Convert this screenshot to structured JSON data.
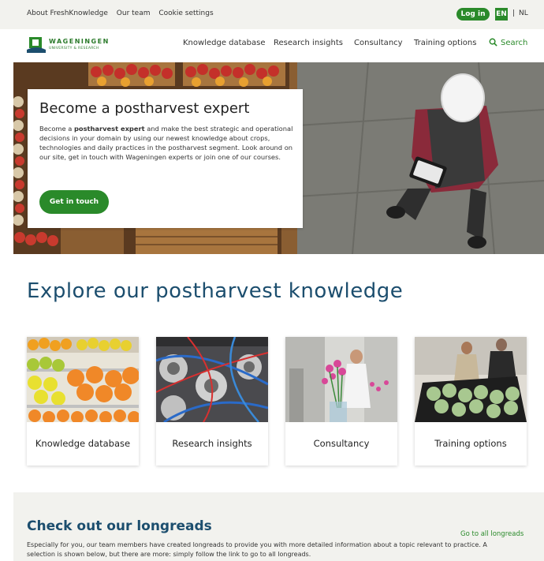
{
  "topbar": {
    "links": [
      "About FreshKnowledge",
      "Our team",
      "Cookie settings"
    ],
    "login_label": "Log in",
    "lang_en": "EN",
    "lang_sep": "|",
    "lang_nl": "NL"
  },
  "logo": {
    "name": "WAGENINGEN",
    "subtitle": "UNIVERSITY & RESEARCH"
  },
  "nav": {
    "items": [
      "Knowledge database",
      "Research insights",
      "Consultancy",
      "Training options"
    ],
    "search_label": "Search"
  },
  "hero": {
    "title": "Become a postharvest expert",
    "intro_pre": "Become a ",
    "intro_bold": "postharvest expert",
    "intro_post": " and make the best strategic and operational decisions in your domain by using our newest knowledge about crops, technologies and daily practices in the postharvest segment. Look around on our site, get in touch with Wageningen experts or join one of our courses.",
    "cta_label": "Get in touch"
  },
  "explore": {
    "title": "Explore our postharvest knowledge",
    "tiles": [
      {
        "label": "Knowledge database",
        "image": "citrus-shelf"
      },
      {
        "label": "Research insights",
        "image": "lab-tubes"
      },
      {
        "label": "Consultancy",
        "image": "flower-storage"
      },
      {
        "label": "Training options",
        "image": "cabbage-crates"
      }
    ]
  },
  "longreads": {
    "title": "Check out our longreads",
    "link_label": "Go to all longreads",
    "text": "Especially for you, our team members have created longreads to provide you with more detailed information about a topic relevant to practice. A selection is shown below, but there are more: simply follow the link to go to all longreads."
  },
  "colors": {
    "brand_green": "#2a8a2a",
    "heading_blue": "#1c4e6e",
    "bar_bg": "#f2f2ee"
  }
}
